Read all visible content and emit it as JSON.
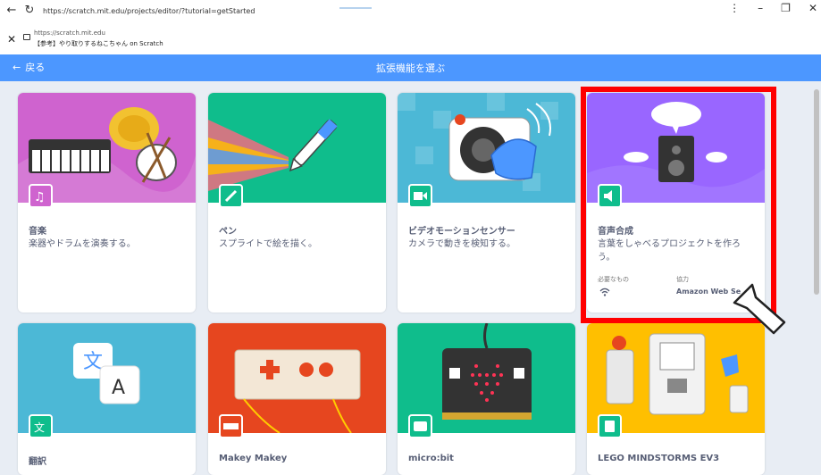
{
  "browser": {
    "url": "https://scratch.mit.edu/projects/editor/?tutorial=getStarted",
    "site_url": "https://scratch.mit.edu",
    "site_title": "【参考】やり取りするねこちゃん on Scratch",
    "back_icon": "←",
    "reload_icon": "↻",
    "close_icon": "✕",
    "menu_icon": "⋮",
    "minimize_icon": "–",
    "restore_icon": "❐",
    "win_close_icon": "✕"
  },
  "header": {
    "back_label": "戻る",
    "title": "拡張機能を選ぶ"
  },
  "cards": [
    {
      "name": "音楽",
      "desc": "楽器やドラムを演奏する。",
      "color": "#cf63cf"
    },
    {
      "name": "ペン",
      "desc": "スプライトで絵を描く。",
      "color": "#0fbd8c"
    },
    {
      "name": "ビデオモーションセンサー",
      "desc": "カメラで動きを検知する。",
      "color": "#0fbd8c"
    },
    {
      "name": "音声合成",
      "desc": "言葉をしゃべるプロジェクトを作ろう。",
      "color": "#9966ff",
      "requirements_label": "必要なもの",
      "collab_label": "協力",
      "partner": "Amazon Web Se"
    },
    {
      "name": "翻訳",
      "color": "#0fbd8c"
    },
    {
      "name": "Makey Makey",
      "color": "#e6461f"
    },
    {
      "name": "micro:bit",
      "color": "#0fbd8c"
    },
    {
      "name": "LEGO MINDSTORMS EV3",
      "color": "#0fbd8c"
    }
  ],
  "annotation": {
    "highlight_color": "#ff0000"
  }
}
